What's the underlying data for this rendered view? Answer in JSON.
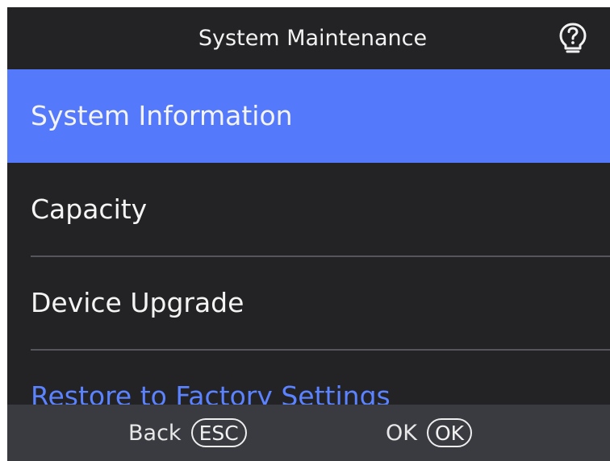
{
  "header": {
    "title": "System Maintenance",
    "help_icon": "question-bulb-icon"
  },
  "menu": {
    "items": [
      {
        "label": "System Information",
        "selected": true
      },
      {
        "label": "Capacity",
        "selected": false
      },
      {
        "label": "Device Upgrade",
        "selected": false
      },
      {
        "label": "Restore to Factory Settings",
        "selected": false
      }
    ]
  },
  "footer": {
    "back_label": "Back",
    "back_key": "ESC",
    "ok_label": "OK",
    "ok_key": "OK"
  },
  "colors": {
    "background": "#232325",
    "selected": "#5479fb",
    "accent_text": "#5b82ff",
    "footer": "#3a3b41"
  }
}
